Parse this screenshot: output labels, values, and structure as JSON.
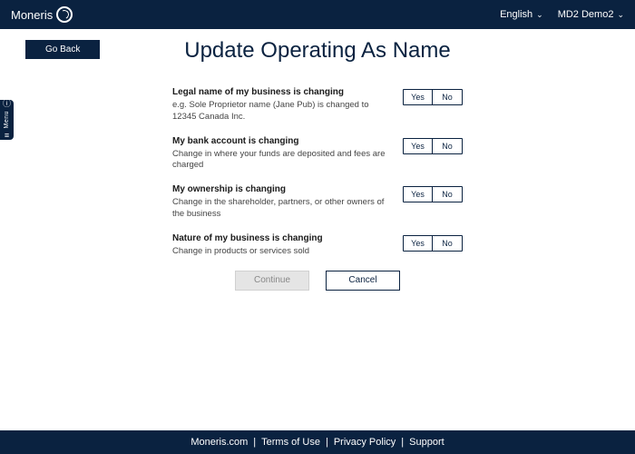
{
  "header": {
    "brand": "Moneris",
    "language": "English",
    "account": "MD2 Demo2"
  },
  "nav": {
    "go_back": "Go Back",
    "side_menu": "Menu"
  },
  "page": {
    "title": "Update Operating As Name"
  },
  "questions": [
    {
      "title": "Legal name of my business is changing",
      "desc": "e.g. Sole Proprietor name (Jane Pub) is changed to 12345 Canada Inc.",
      "yes": "Yes",
      "no": "No"
    },
    {
      "title": "My bank account is changing",
      "desc": "Change in where your funds are deposited and fees are charged",
      "yes": "Yes",
      "no": "No"
    },
    {
      "title": "My ownership is changing",
      "desc": "Change in the shareholder, partners, or other owners of the business",
      "yes": "Yes",
      "no": "No"
    },
    {
      "title": "Nature of my business is changing",
      "desc": "Change in products or services sold",
      "yes": "Yes",
      "no": "No"
    }
  ],
  "actions": {
    "continue": "Continue",
    "cancel": "Cancel"
  },
  "footer": {
    "links": [
      "Moneris.com",
      "Terms of Use",
      "Privacy Policy",
      "Support"
    ]
  }
}
